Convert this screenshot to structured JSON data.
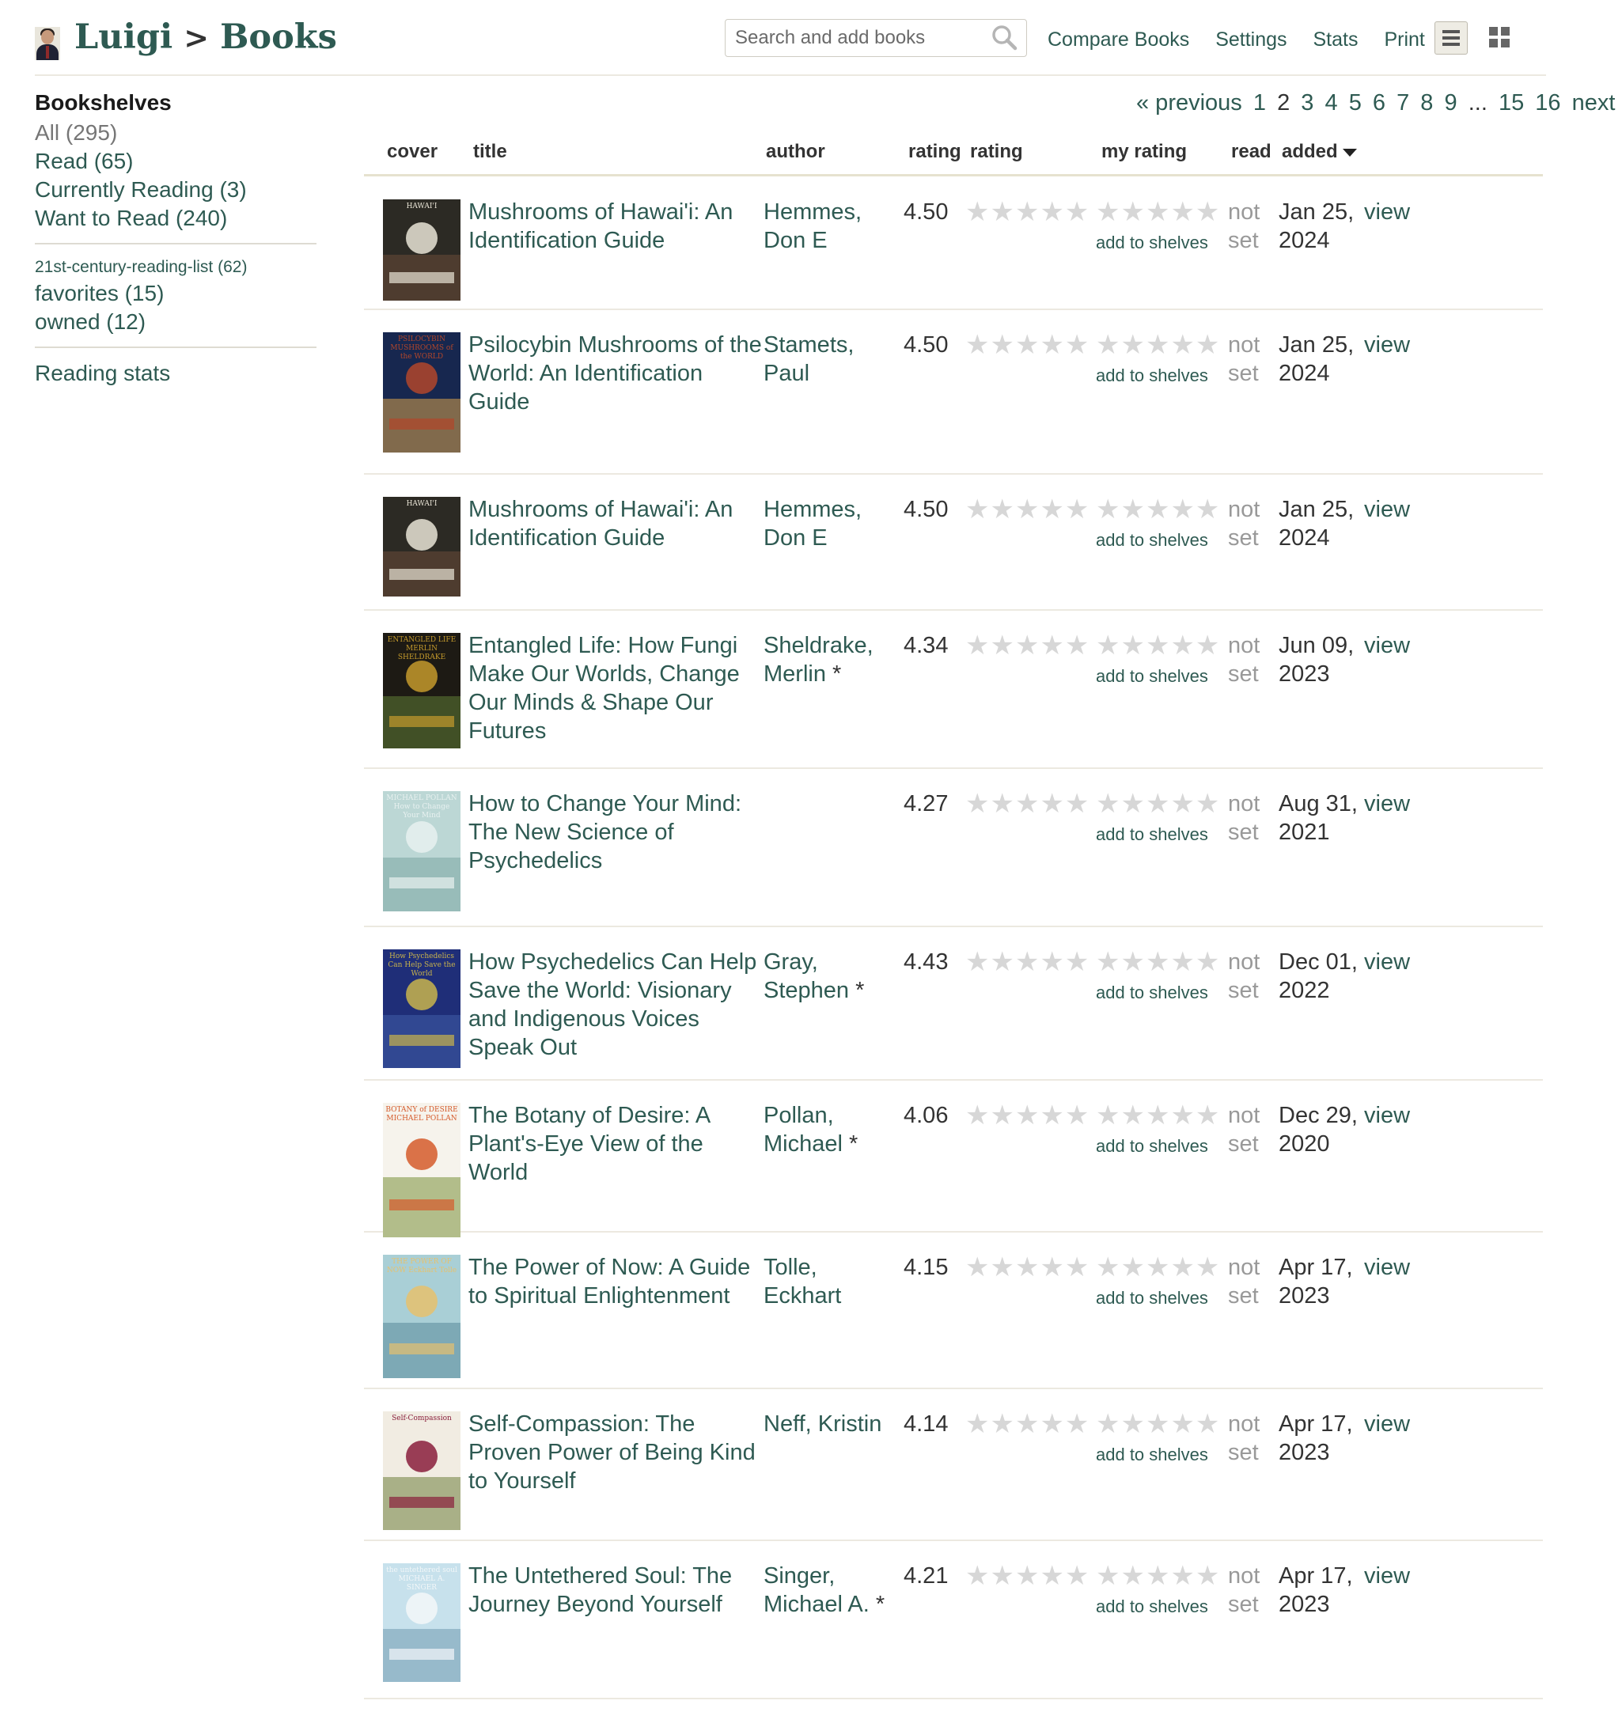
{
  "header": {
    "user_name": "Luigi",
    "separator": ">",
    "section": "Books",
    "search_placeholder": "Search and add books",
    "links": [
      "Compare Books",
      "Settings",
      "Stats",
      "Print"
    ],
    "divider": "|"
  },
  "sidebar": {
    "title": "Bookshelves",
    "shelves": [
      "All (295)",
      "Read (65)",
      "Currently Reading (3)",
      "Want to Read (240)"
    ],
    "custom_shelves": [
      "21st-century-reading-list (62)",
      "favorites (15)",
      "owned (12)"
    ],
    "stats_link": "Reading stats"
  },
  "pagination": {
    "prev": "« previous",
    "pages": [
      "1",
      "2",
      "3",
      "4",
      "5",
      "6",
      "7",
      "8",
      "9",
      "...",
      "15",
      "16"
    ],
    "current": "2",
    "next": "next »"
  },
  "table": {
    "columns": [
      "cover",
      "title",
      "author",
      "rating",
      "rating",
      "my rating",
      "read",
      "added"
    ],
    "add_to_shelves": "add to shelves",
    "view_label": "view",
    "rows": [
      {
        "title": "Mushrooms of Hawai'i: An Identification Guide",
        "author": "Hemmes, Don E",
        "author_star": "",
        "avg_rating": "4.50",
        "read": "not set",
        "added": "Jan 25, 2024"
      },
      {
        "title": "Psilocybin Mushrooms of the World: An Identification Guide",
        "author": "Stamets, Paul",
        "author_star": "",
        "avg_rating": "4.50",
        "read": "not set",
        "added": "Jan 25, 2024"
      },
      {
        "title": "Mushrooms of Hawai'i: An Identification Guide",
        "author": "Hemmes, Don E",
        "author_star": "",
        "avg_rating": "4.50",
        "read": "not set",
        "added": "Jan 25, 2024"
      },
      {
        "title": "Entangled Life: How Fungi Make Our Worlds, Change Our Minds & Shape Our Futures",
        "author": "Sheldrake, Merlin",
        "author_star": "*",
        "avg_rating": "4.34",
        "read": "not set",
        "added": "Jun 09, 2023"
      },
      {
        "title": "How to Change Your Mind: The New Science of Psychedelics",
        "author": "",
        "author_star": "",
        "avg_rating": "4.27",
        "read": "not set",
        "added": "Aug 31, 2021"
      },
      {
        "title": "How Psychedelics Can Help Save the World: Visionary and Indigenous Voices Speak Out",
        "author": "Gray, Stephen",
        "author_star": "*",
        "avg_rating": "4.43",
        "read": "not set",
        "added": "Dec 01, 2022"
      },
      {
        "title": "The Botany of Desire: A Plant's-Eye View of the World",
        "author": "Pollan, Michael",
        "author_star": "*",
        "avg_rating": "4.06",
        "read": "not set",
        "added": "Dec 29, 2020"
      },
      {
        "title": "The Power of Now: A Guide to Spiritual Enlightenment",
        "author": "Tolle, Eckhart",
        "author_star": "",
        "avg_rating": "4.15",
        "read": "not set",
        "added": "Apr 17, 2023"
      },
      {
        "title": "Self-Compassion: The Proven Power of Being Kind to Yourself",
        "author": "Neff, Kristin",
        "author_star": "",
        "avg_rating": "4.14",
        "read": "not set",
        "added": "Apr 17, 2023"
      },
      {
        "title": "The Untethered Soul: The Journey Beyond Yourself",
        "author": "Singer, Michael A.",
        "author_star": "*",
        "avg_rating": "4.21",
        "read": "not set",
        "added": "Apr 17, 2023"
      }
    ]
  },
  "covers": [
    {
      "text": "HAWAI'I",
      "colors": [
        "#2c2a24",
        "#e9e4d6",
        "#6b4a39"
      ]
    },
    {
      "text": "PSILOCYBIN MUSHROOMS of the WORLD",
      "colors": [
        "#17274f",
        "#b2462a",
        "#d9a24b"
      ]
    },
    {
      "text": "HAWAI'I",
      "colors": [
        "#2c2a24",
        "#e9e4d6",
        "#6b4a39"
      ]
    },
    {
      "text": "ENTANGLED LIFE MERLIN SHELDRAKE",
      "colors": [
        "#1d1a14",
        "#c49a2c",
        "#5f7d34"
      ]
    },
    {
      "text": "MICHAEL POLLAN How to Change Your Mind",
      "colors": [
        "#bcd7d5",
        "#e8f1f0",
        "#7aa6a3"
      ]
    },
    {
      "text": "How Psychedelics Can Help Save the World",
      "colors": [
        "#1f2e78",
        "#c9b44c",
        "#3f5ea8"
      ]
    },
    {
      "text": "BOTANY of DESIRE MICHAEL POLLAN",
      "colors": [
        "#f6f3ec",
        "#d55a2b",
        "#7a8f3a"
      ]
    },
    {
      "text": "THE POWER OF NOW Eckhart Tolle",
      "colors": [
        "#a9cfd6",
        "#e6c16d",
        "#5a8b9b"
      ]
    },
    {
      "text": "Self-Compassion",
      "colors": [
        "#f1ece2",
        "#8a1f3c",
        "#6e7f3d"
      ]
    },
    {
      "text": "the untethered soul MICHAEL A. SINGER",
      "colors": [
        "#c7e1ec",
        "#f3f7f9",
        "#6f9ab0"
      ]
    }
  ]
}
